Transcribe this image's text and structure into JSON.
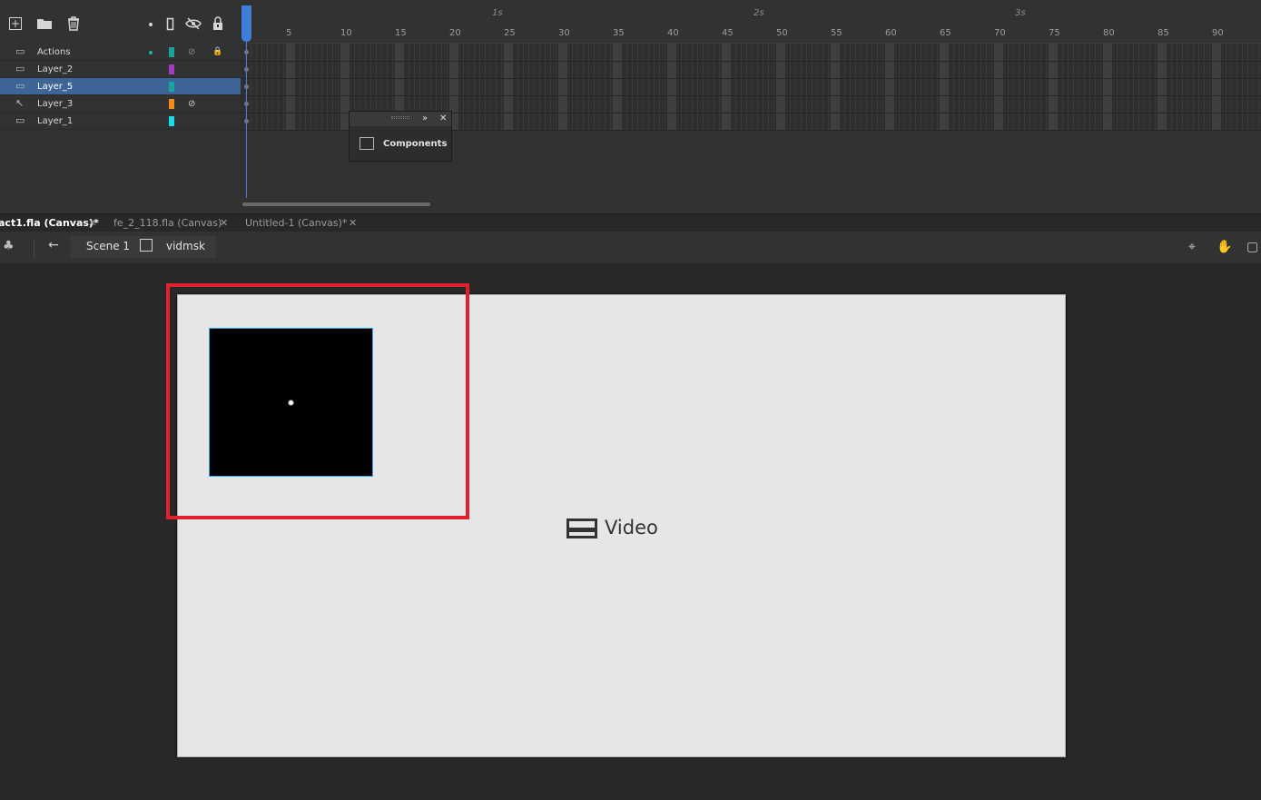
{
  "timeline": {
    "header_icons": [
      "new-layer-icon",
      "new-folder-icon",
      "delete-icon",
      "highlight-dot-icon",
      "outline-icon",
      "hide-icon",
      "lock-icon"
    ],
    "layers": [
      {
        "name": "Actions",
        "color": "#17a398",
        "selected": false,
        "type": "normal",
        "hidden": true,
        "locked": true
      },
      {
        "name": "Layer_2",
        "color": "#a23bc2",
        "selected": false,
        "type": "normal",
        "hidden": false,
        "locked": false
      },
      {
        "name": "Layer_5",
        "color": "#16a5a0",
        "selected": true,
        "type": "normal",
        "hidden": false,
        "locked": false
      },
      {
        "name": "Layer_3",
        "color": "#f28a1c",
        "selected": false,
        "type": "motion-guide",
        "hidden": true,
        "locked": false
      },
      {
        "name": "Layer_1",
        "color": "#18dce8",
        "selected": false,
        "type": "normal",
        "hidden": false,
        "locked": false
      }
    ],
    "seconds": [
      "1s",
      "2s",
      "3s"
    ],
    "frame_numbers": [
      "5",
      "10",
      "15",
      "20",
      "25",
      "30",
      "35",
      "40",
      "45",
      "50",
      "55",
      "60",
      "65",
      "70",
      "75",
      "80",
      "85",
      "90"
    ],
    "current_frame": 1
  },
  "components_panel": {
    "label": "Components"
  },
  "tabs": [
    {
      "label": "act1.fla (Canvas)*",
      "active": true
    },
    {
      "label": "fe_2_118.fla (Canvas)",
      "active": false
    },
    {
      "label": "Untitled-1 (Canvas)*",
      "active": false
    }
  ],
  "edit_bar": {
    "scene": "Scene 1",
    "symbol": "vidmsk"
  },
  "stage": {
    "background": "#e6e6e6",
    "video_label": "Video"
  }
}
